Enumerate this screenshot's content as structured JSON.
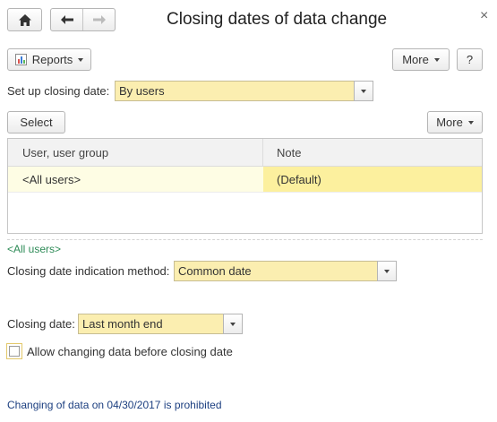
{
  "window": {
    "title": "Closing dates of data change",
    "close_glyph": "×"
  },
  "toolbar": {
    "reports_label": "Reports",
    "more_label": "More",
    "help_label": "?"
  },
  "setup": {
    "label": "Set up closing date:",
    "value": "By users"
  },
  "list": {
    "select_label": "Select",
    "more_label": "More",
    "columns": [
      "User, user group",
      "Note"
    ],
    "rows": [
      {
        "user": "<All users>",
        "note": "(Default)"
      }
    ]
  },
  "details": {
    "group_title": "<All users>",
    "method_label": "Closing date indication method:",
    "method_value": "Common date",
    "closing_label": "Closing date:",
    "closing_value": "Last month end",
    "allow_label": "Allow changing data before closing date",
    "allow_checked": false,
    "status_text": "Changing of data on 04/30/2017 is prohibited"
  },
  "colors": {
    "field_bg": "#fbeeb0",
    "selected_row": "#fefde4",
    "selected_cell": "#fcf09e",
    "link_green": "#2e8b57",
    "status_blue": "#1c3f80"
  }
}
